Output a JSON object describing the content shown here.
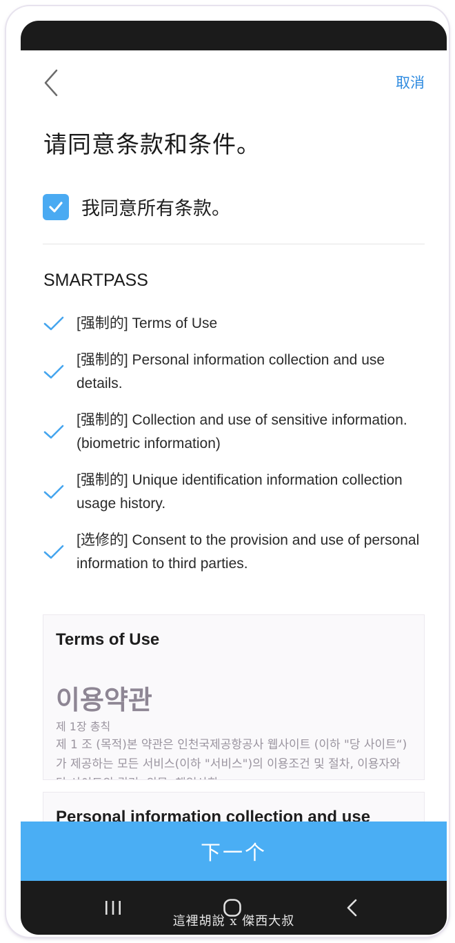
{
  "header": {
    "cancel_label": "取消"
  },
  "page_title": "请同意条款和条件。",
  "agree_all_label": "我同意所有条款。",
  "section_title": "SMARTPASS",
  "terms": [
    {
      "label": "[强制的] Terms of Use"
    },
    {
      "label": "[强制的] Personal information collection and use details."
    },
    {
      "label": "[强制的] Collection and use of sensitive information. (biometric information)"
    },
    {
      "label": "[强制的] Unique identification information collection usage history."
    },
    {
      "label": "[选修的] Consent to the provision and use of personal information to third parties."
    }
  ],
  "card_terms": {
    "title": "Terms of Use",
    "heading": "이용약관",
    "chapter": "제 1장 총칙",
    "body": "제 1 조 (목적)본 약관은 인천국제공항공사 웹사이트 (이하 \"당 사이트“)가 제공하는 모든 서비스(이하 \"서비스\")의 이용조건 및 절차, 이용자와 당 사이트의 권리, 의무, 책임사항"
  },
  "card_personal": {
    "title": "Personal information collection and use"
  },
  "next_button_label": "下一个",
  "watermark": "這裡胡說 x 傑西大叔",
  "colors": {
    "accent": "#4aaef4",
    "link": "#2f8be0",
    "check": "#4aaaf2"
  },
  "icons": {
    "back": "chevron-left-icon",
    "checkbox": "checkbox-checked-icon",
    "check": "checkmark-icon",
    "recents": "recents-icon",
    "home": "home-icon",
    "nav_back": "nav-back-icon"
  }
}
